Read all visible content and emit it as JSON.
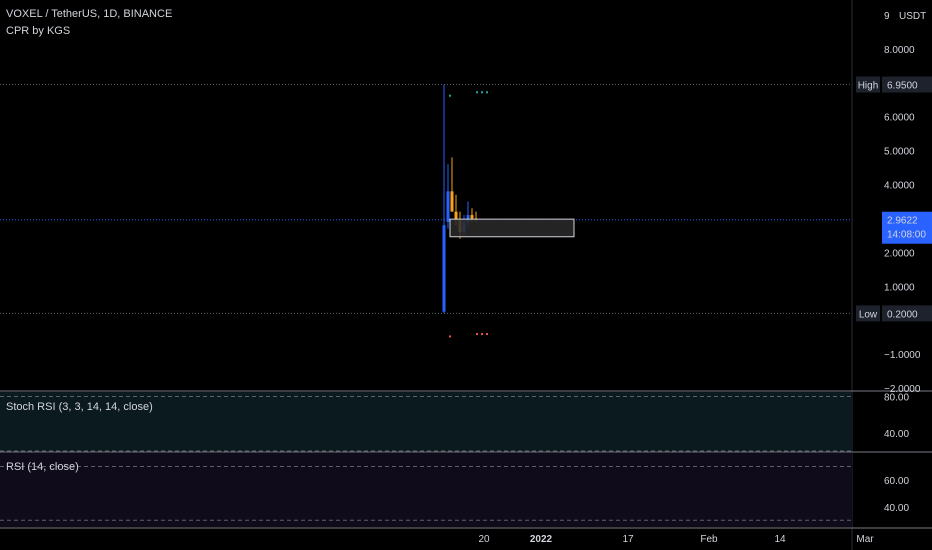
{
  "header": {
    "title": "VOXEL / TetherUS, 1D, BINANCE",
    "indicator": "CPR by KGS"
  },
  "chart_data": {
    "type": "candlestick",
    "symbol": "VOXEL / TetherUS",
    "interval": "1D",
    "exchange": "BINANCE",
    "currency_label": "USDT",
    "y_axis": {
      "ylim": [
        -2.0,
        9.0
      ],
      "ticks": [
        "9",
        "8.0000",
        "6.0000",
        "5.0000",
        "4.0000",
        "2.0000",
        "1.0000",
        "−1.0000",
        "−2.0000"
      ],
      "tick_values": [
        9,
        8,
        6,
        5,
        4,
        2,
        1,
        -1,
        -2
      ]
    },
    "x_axis": {
      "ticks": [
        {
          "label": "20",
          "bold": false
        },
        {
          "label": "2022",
          "bold": true
        },
        {
          "label": "17",
          "bold": false
        },
        {
          "label": "Feb",
          "bold": false
        },
        {
          "label": "14",
          "bold": false
        },
        {
          "label": "Mar",
          "bold": false
        }
      ]
    },
    "price_lines": [
      {
        "name": "High",
        "value": 6.95,
        "value_label": "6.9500",
        "color": "#131722",
        "tag_color": "#1e222d"
      },
      {
        "name": "Low",
        "value": 0.2,
        "value_label": "0.2000",
        "color": "#131722",
        "tag_color": "#1e222d"
      }
    ],
    "last_price": {
      "value": 2.9622,
      "value_label": "2.9622",
      "countdown": "14:08:00",
      "color": "#2962ff"
    },
    "candles": [
      {
        "open": 2.8,
        "high": 6.95,
        "low": 0.2,
        "close": 0.25
      },
      {
        "open": 2.9,
        "high": 4.6,
        "low": 2.7,
        "close": 3.8
      },
      {
        "open": 3.8,
        "high": 4.8,
        "low": 3.3,
        "close": 3.2
      },
      {
        "open": 3.2,
        "high": 3.7,
        "low": 2.8,
        "close": 2.95
      },
      {
        "open": 2.95,
        "high": 3.2,
        "low": 2.4,
        "close": 2.6
      },
      {
        "open": 2.6,
        "high": 3.1,
        "low": 2.5,
        "close": 2.9
      },
      {
        "open": 2.9,
        "high": 3.5,
        "low": 2.8,
        "close": 3.1
      },
      {
        "open": 3.1,
        "high": 3.3,
        "low": 2.9,
        "close": 3.0
      },
      {
        "open": 3.0,
        "high": 3.2,
        "low": 2.9,
        "close": 2.96
      }
    ],
    "cpr_box": {
      "top": 2.98,
      "bottom": 2.46
    },
    "pivot_dots_top": [
      6.65,
      6.75,
      6.75,
      6.75
    ],
    "pivot_dots_bottom": [
      -0.45,
      -0.38,
      -0.38,
      -0.38
    ],
    "panes": [
      {
        "name": "Stoch RSI (3, 3, 14, 14, close)",
        "ticks": [
          "80.00",
          "40.00"
        ],
        "tick_values": [
          80,
          40
        ],
        "ylim": [
          20,
          85
        ],
        "bands": [
          80,
          20
        ]
      },
      {
        "name": "RSI (14, close)",
        "ticks": [
          "60.00",
          "40.00"
        ],
        "tick_values": [
          60,
          40
        ],
        "ylim": [
          25,
          80
        ],
        "bands": [
          70,
          30
        ]
      }
    ]
  },
  "colors": {
    "up": "#f7a21b",
    "down": "#2962ff",
    "grid": "#1f1f1f",
    "pivot_high": "#26a69a",
    "pivot_low": "#ef5350",
    "stoch_bg": "#0b1a1f",
    "rsi_bg": "#100b1a"
  }
}
